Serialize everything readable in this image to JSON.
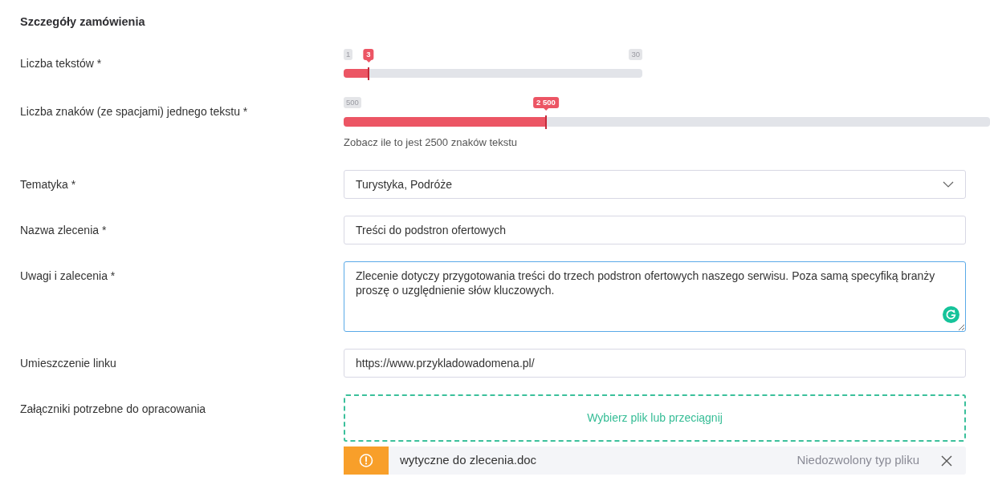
{
  "section_title": "Szczegóły zamówienia",
  "fields": [
    {
      "kind": "slider",
      "label": "Liczba tekstów *",
      "min_label": "1",
      "max_label": "30",
      "value_label": "3",
      "level": 0.083
    },
    {
      "kind": "slider",
      "label": "Liczba znaków (ze spacjami) jednego tekstu *",
      "min_label": "500",
      "value_label": "2 500",
      "level": 0.313,
      "hint": "Zobacz ile to jest 2500 znaków tekstu"
    },
    {
      "kind": "select",
      "label": "Tematyka *",
      "value": "Turystyka, Podróże",
      "focused": false
    },
    {
      "kind": "input",
      "label": "Nazwa zlecenia *",
      "value": "Treści do podstron ofertowych",
      "focused": false
    },
    {
      "kind": "textarea",
      "label": "Uwagi i zalecenia *",
      "value": "Zlecenie dotyczy przygotowania treści do trzech podstron ofertowych naszego serwisu. Poza samą specyfiką branży proszę o uzględnienie słów kluczowych.",
      "focused": true
    },
    {
      "kind": "input",
      "label": "Umieszczenie linku",
      "value": "https://www.przykladowadomena.pl/",
      "focused": false
    },
    {
      "kind": "upload",
      "label": "Załączniki potrzebne do opracowania",
      "drop_text": "Wybierz plik lub przeciągnij",
      "files": [
        {
          "name": "wytyczne do zlecenia.doc",
          "error": "Niedozwolony typ pliku"
        }
      ]
    }
  ]
}
